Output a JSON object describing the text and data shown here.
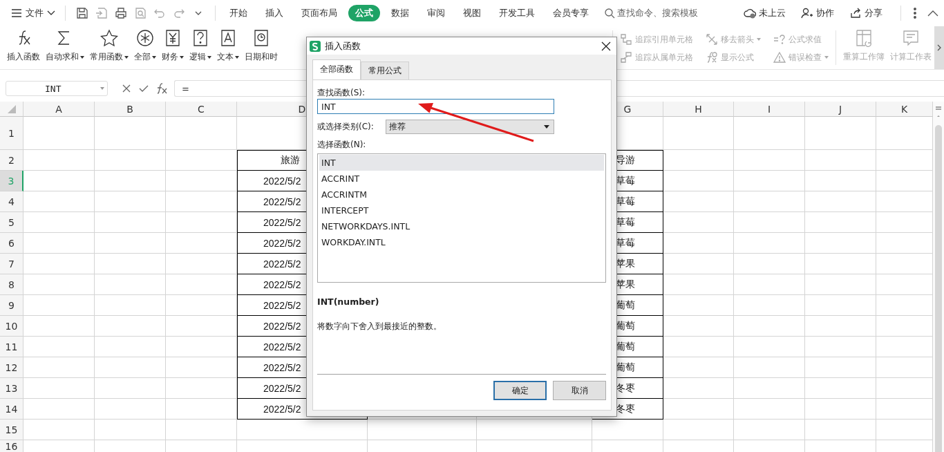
{
  "menu_bar": {
    "file_menu": "文件",
    "tabs": [
      {
        "label": "开始",
        "selected": false
      },
      {
        "label": "插入",
        "selected": false
      },
      {
        "label": "页面布局",
        "selected": false
      },
      {
        "label": "公式",
        "selected": true
      },
      {
        "label": "数据",
        "selected": false
      },
      {
        "label": "审阅",
        "selected": false
      },
      {
        "label": "视图",
        "selected": false
      },
      {
        "label": "开发工具",
        "selected": false
      },
      {
        "label": "会员专享",
        "selected": false
      }
    ],
    "search": {
      "placeholder": "查找命令、搜索模板"
    },
    "actions": [
      "未上云",
      "协作",
      "分享"
    ]
  },
  "ribbon": {
    "function_buttons": [
      {
        "label": "插入函数",
        "dropdown": false
      },
      {
        "label": "自动求和",
        "dropdown": true
      },
      {
        "label": "常用函数",
        "dropdown": true
      },
      {
        "label": "全部",
        "dropdown": true
      },
      {
        "label": "财务",
        "dropdown": true
      },
      {
        "label": "逻辑",
        "dropdown": true
      },
      {
        "label": "文本",
        "dropdown": true
      },
      {
        "label": "日期和时",
        "dropdown": false
      }
    ],
    "audit_tools": [
      {
        "label": "追踪引用单元格",
        "dropdown": false,
        "disabled": true
      },
      {
        "label": "追踪从属单元格",
        "dropdown": false,
        "disabled": true
      },
      {
        "label": "移去箭头",
        "dropdown": true,
        "disabled": true
      },
      {
        "label": "显示公式",
        "dropdown": false,
        "disabled": true
      },
      {
        "label": "公式求值",
        "dropdown": false,
        "disabled": true
      },
      {
        "label": "错误检查",
        "dropdown": true,
        "disabled": true
      }
    ],
    "calc_buttons": [
      {
        "label": "重算工作簿",
        "disabled": true
      },
      {
        "label": "计算工作表",
        "disabled": true
      }
    ]
  },
  "formula_bar": {
    "name_box": "INT",
    "formula": "="
  },
  "sheet": {
    "columns": [
      "A",
      "B",
      "C",
      "D",
      "G",
      "H",
      "I",
      "J",
      "K"
    ],
    "rows": [
      {
        "number": "1",
        "selected": false
      },
      {
        "number": "2",
        "selected": false,
        "column_d": "旅游",
        "column_g": "导游"
      },
      {
        "number": "3",
        "selected": true,
        "column_d": "2022/5/2",
        "column_g": "草莓"
      },
      {
        "number": "4",
        "selected": false,
        "column_d": "2022/5/2",
        "column_g": "草莓"
      },
      {
        "number": "5",
        "selected": false,
        "column_d": "2022/5/2",
        "column_g": "草莓"
      },
      {
        "number": "6",
        "selected": false,
        "column_d": "2022/5/2",
        "column_g": "草莓"
      },
      {
        "number": "7",
        "selected": false,
        "column_d": "2022/5/2",
        "column_g": "苹果"
      },
      {
        "number": "8",
        "selected": false,
        "column_d": "2022/5/2",
        "column_g": "苹果"
      },
      {
        "number": "9",
        "selected": false,
        "column_d": "2022/5/2",
        "column_g": "葡萄"
      },
      {
        "number": "10",
        "selected": false,
        "column_d": "2022/5/2",
        "column_g": "葡萄"
      },
      {
        "number": "11",
        "selected": false,
        "column_d": "2022/5/2",
        "column_g": "葡萄"
      },
      {
        "number": "12",
        "selected": false,
        "column_d": "2022/5/2",
        "column_g": "葡萄"
      },
      {
        "number": "13",
        "selected": false,
        "column_d": "2022/5/2",
        "column_g": "冬枣"
      },
      {
        "number": "14",
        "selected": false,
        "column_d": "2022/5/2",
        "column_g": "冬枣"
      },
      {
        "number": "15",
        "selected": false
      },
      {
        "number": "16",
        "selected": false
      }
    ]
  },
  "dialog": {
    "title": "插入函数",
    "tabs": [
      {
        "label": "全部函数",
        "selected": true
      },
      {
        "label": "常用公式",
        "selected": false
      }
    ],
    "search_label": "查找函数(S):",
    "search_value": "INT",
    "category_label": "或选择类别(C):",
    "category": "推荐",
    "function_label": "选择函数(N):",
    "functions": [
      {
        "name": "INT",
        "selected": true
      },
      {
        "name": "ACCRINT",
        "selected": false
      },
      {
        "name": "ACCRINTM",
        "selected": false
      },
      {
        "name": "INTERCEPT",
        "selected": false
      },
      {
        "name": "NETWORKDAYS.INTL",
        "selected": false
      },
      {
        "name": "WORKDAY.INTL",
        "selected": false
      }
    ],
    "signature": "INT(number)",
    "description": "将数字向下舍入到最接近的整数。",
    "buttons": [
      {
        "label": "确定",
        "default": true
      },
      {
        "label": "取消",
        "default": false
      }
    ]
  }
}
